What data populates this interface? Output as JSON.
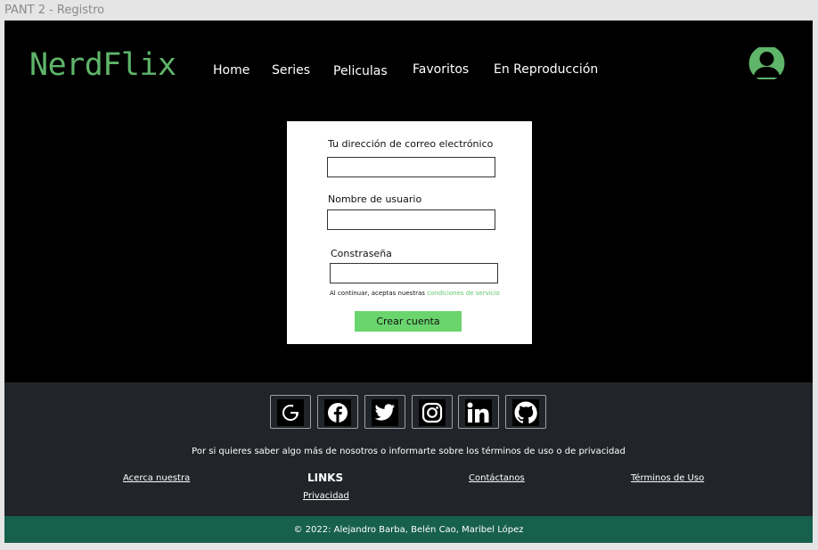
{
  "frame_title": "PANT 2 - Registro",
  "header": {
    "logo": "NerdFlix",
    "nav": [
      "Home",
      "Series",
      "Peliculas",
      "Favoritos",
      "En Reproducción"
    ]
  },
  "form": {
    "email_label": "Tu dirección de correo electrónico",
    "email_value": "",
    "username_label": "Nombre de usuario",
    "username_value": "",
    "password_label": "Constraseña",
    "password_value": "",
    "terms_prefix": "Al continuar, aceptas nuestras",
    "terms_link": "condiciones de servicio",
    "submit_label": "Crear cuenta"
  },
  "footer": {
    "social": [
      "google",
      "facebook",
      "twitter",
      "instagram",
      "linkedin",
      "github"
    ],
    "info_text": "Por si quieres saber algo más de nosotros o informarte sobre los términos de uso o de privacidad",
    "links_heading": "LINKS",
    "link_about": "Acerca nuestra",
    "link_contact": "Contáctanos",
    "link_terms": "Términos de Uso",
    "link_privacy": "Privacidad",
    "copyright": "© 2022: Alejandro Barba, Belén Cao, Maribel López"
  },
  "colors": {
    "brand_green": "#5fb56a",
    "button_green": "#6ad46d",
    "footer_bg": "#212529",
    "copyright_bg": "#17604c"
  }
}
